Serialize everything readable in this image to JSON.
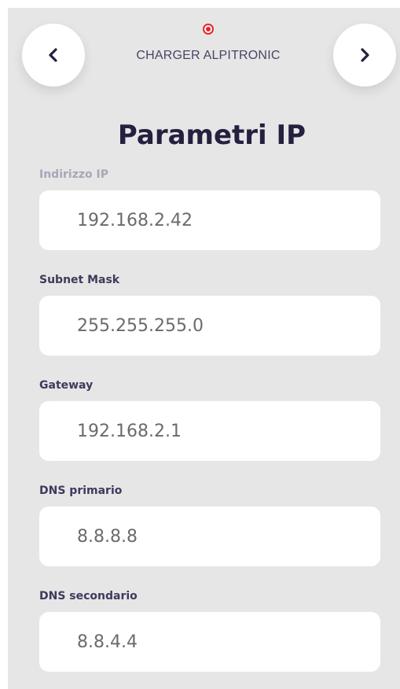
{
  "header": {
    "device_name": "CHARGER ALPITRONIC",
    "status_color": "#e8232a",
    "prev_icon": "chevron-left-icon",
    "next_icon": "chevron-right-icon"
  },
  "page": {
    "title": "Parametri IP"
  },
  "fields": [
    {
      "label": "Indirizzo IP",
      "value": "192.168.2.42"
    },
    {
      "label": "Subnet Mask",
      "value": "255.255.255.0"
    },
    {
      "label": "Gateway",
      "value": "192.168.2.1"
    },
    {
      "label": "DNS primario",
      "value": "8.8.8.8"
    },
    {
      "label": "DNS secondario",
      "value": "8.8.4.4"
    }
  ]
}
